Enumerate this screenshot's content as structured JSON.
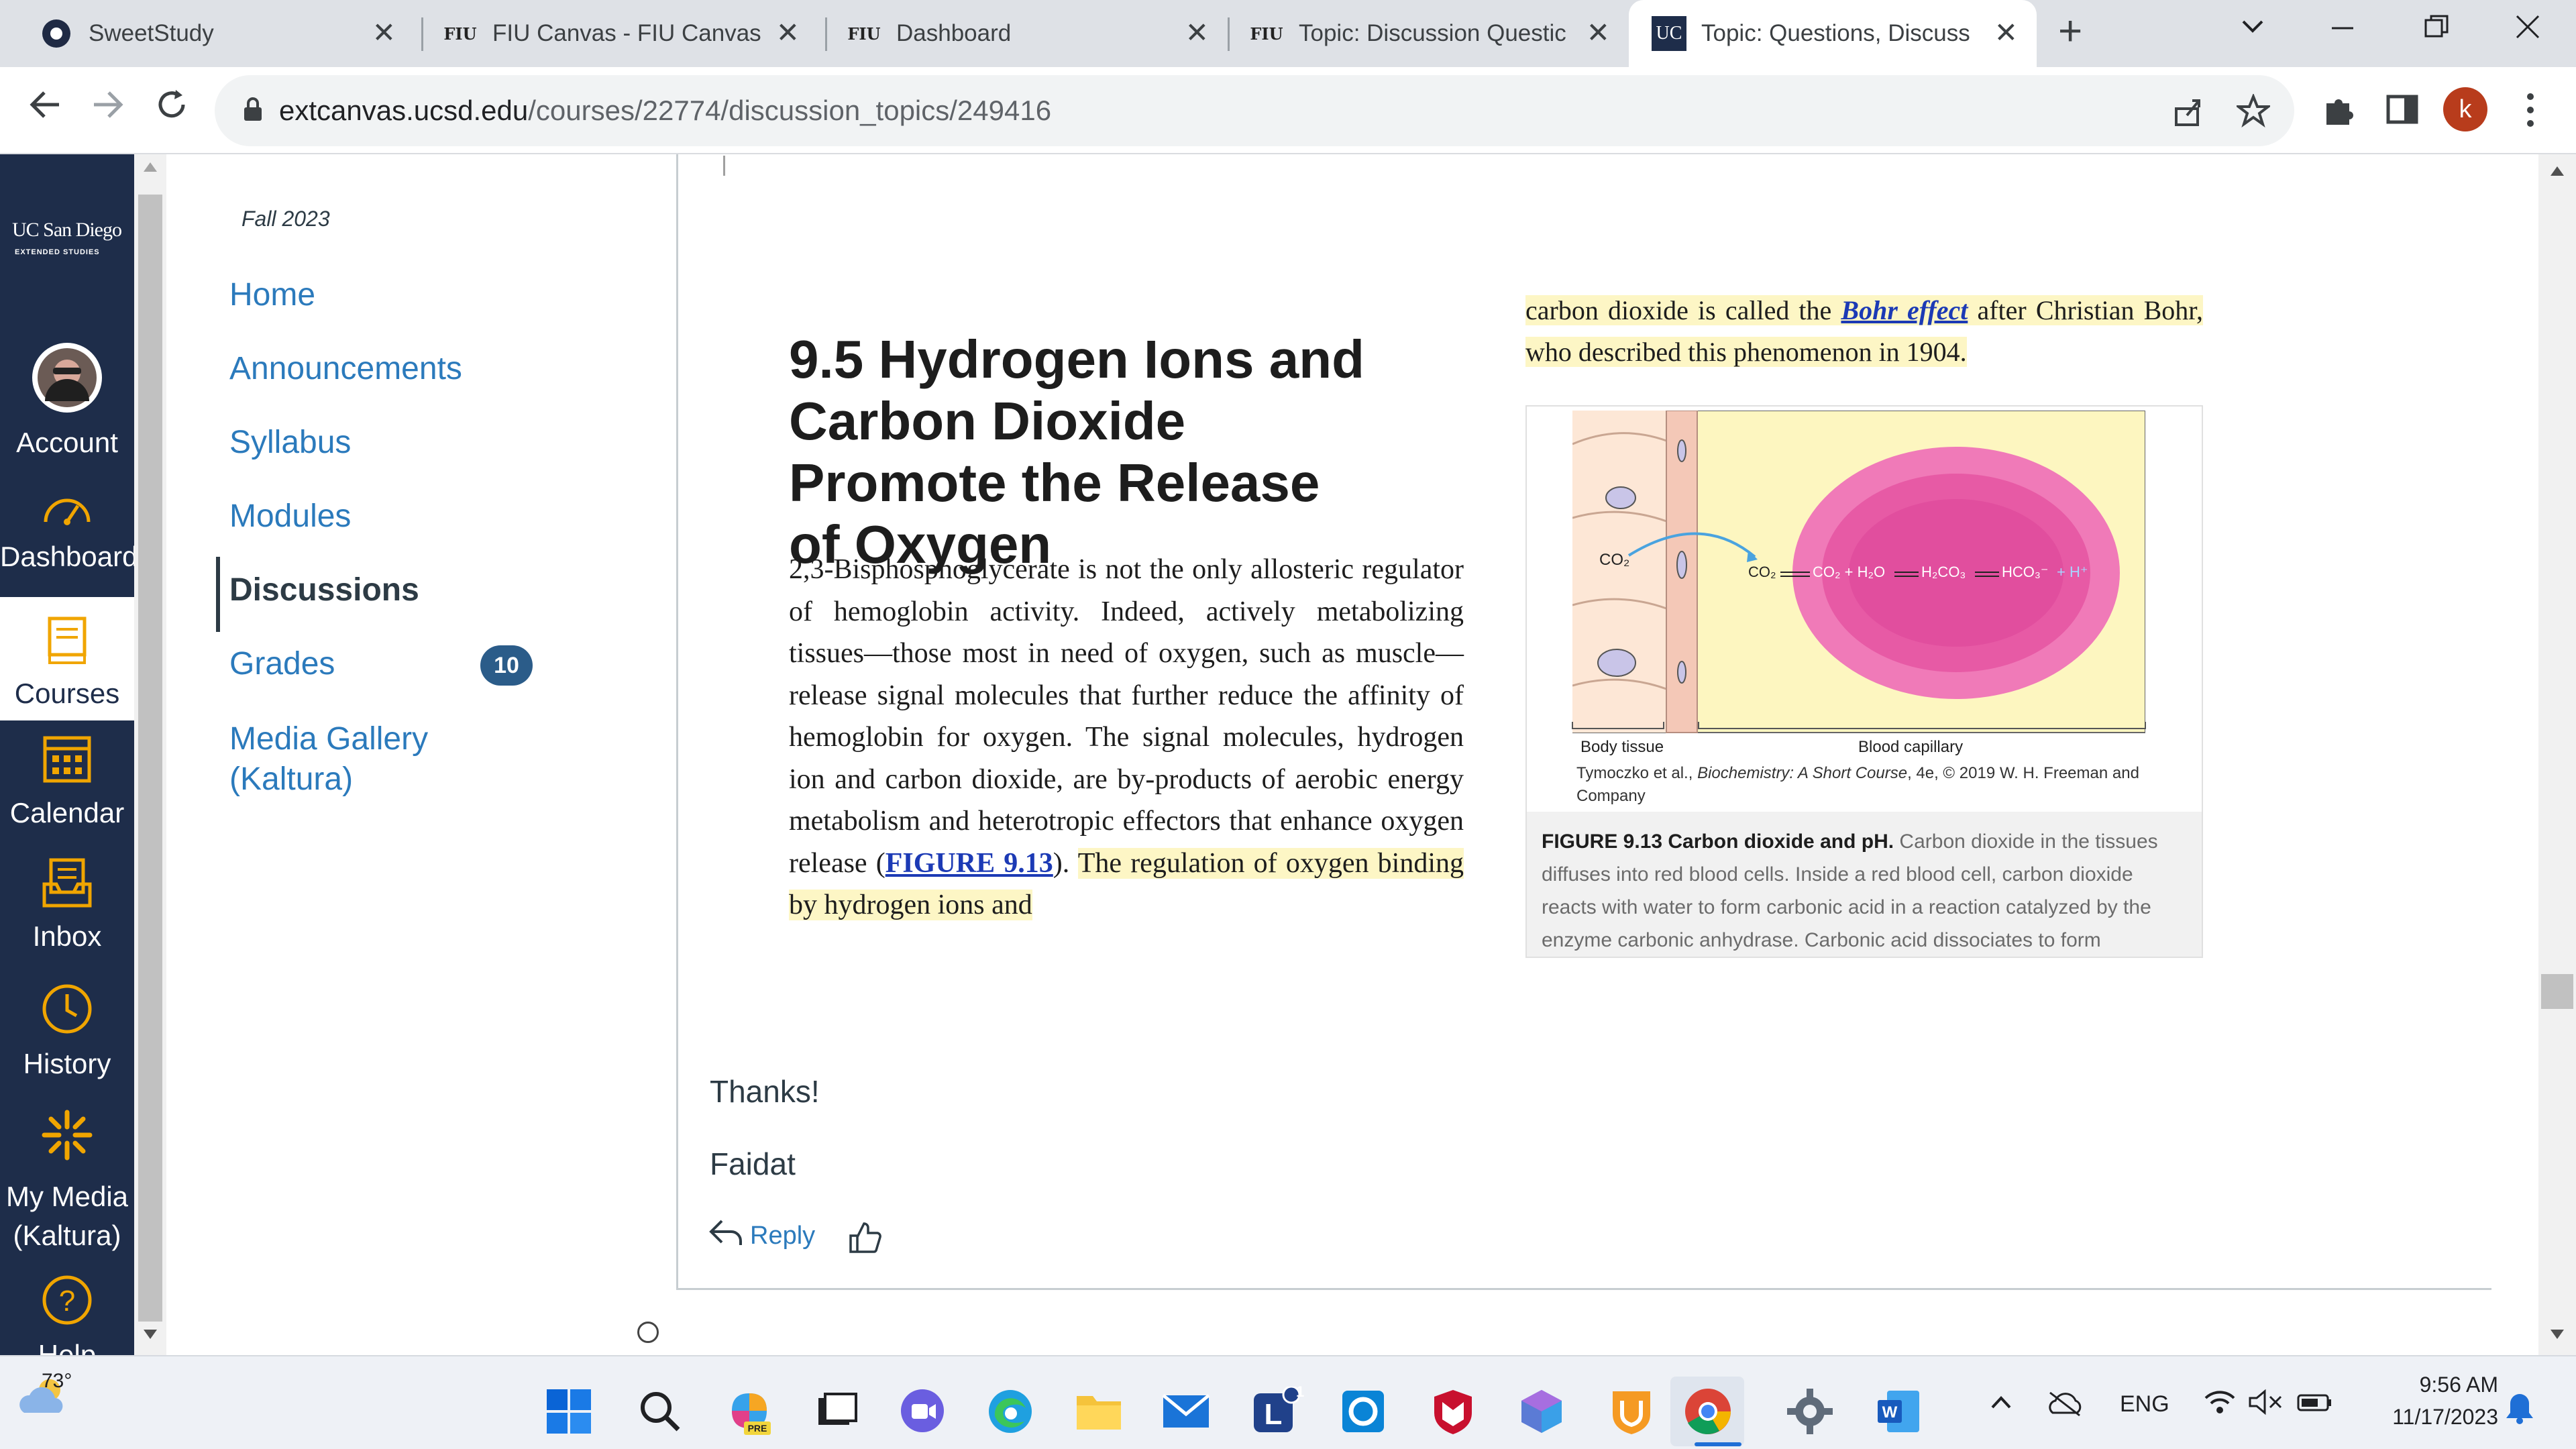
{
  "browser": {
    "tabs": [
      {
        "label": "SweetStudy"
      },
      {
        "label": "FIU Canvas - FIU Canvas"
      },
      {
        "label": "Dashboard"
      },
      {
        "label": "Topic: Discussion Questic"
      },
      {
        "label": "Topic: Questions, Discuss"
      }
    ],
    "tab_favicons": {
      "fiu": "FIU",
      "ucsd": "UC"
    },
    "url_host": "extcanvas.ucsd.edu",
    "url_path": "/courses/22774/discussion_topics/249416",
    "profile_initial": "k"
  },
  "global_nav": {
    "logo_main": "UC San Diego",
    "logo_sub": "EXTENDED STUDIES",
    "items": [
      {
        "label": "Account"
      },
      {
        "label": "Dashboard"
      },
      {
        "label": "Courses"
      },
      {
        "label": "Calendar"
      },
      {
        "label": "Inbox"
      },
      {
        "label": "History"
      },
      {
        "label": "My Media (Kaltura)"
      },
      {
        "label": "Help"
      }
    ]
  },
  "course_nav": {
    "term": "Fall 2023",
    "items": [
      {
        "label": "Home"
      },
      {
        "label": "Announcements"
      },
      {
        "label": "Syllabus"
      },
      {
        "label": "Modules"
      },
      {
        "label": "Discussions"
      },
      {
        "label": "Grades"
      },
      {
        "label": "Media Gallery (Kaltura)"
      }
    ],
    "grades_badge": "10"
  },
  "article": {
    "title": "9.5 Hydrogen Ions and Carbon Dioxide Promote the Release of Oxygen",
    "p_text": "2,3-Bisphosphoglycerate is not the only allosteric regulator of hemoglobin activity. Indeed, actively metabolizing tissues—those most in need of oxygen, such as muscle—release signal molecules that further reduce the affinity of hemoglobin for oxygen. The signal molecules, hydrogen ion and carbon dioxide, are by-products of aerobic energy metabolism and heterotropic effectors that enhance oxygen release (",
    "p_link": "FIGURE 9.13",
    "p_after": ").",
    "p_highlight": "The regulation of oxygen binding by hydrogen ions and",
    "right_pre": "carbon dioxide is called the ",
    "right_link": "Bohr effect",
    "right_post": " after Christian Bohr, who described this phenomenon in 1904."
  },
  "figure": {
    "co2_left": "CO₂",
    "eq_co2": "CO₂",
    "eq_co2_h2o": "CO₂ + H₂O",
    "eq_h2co3": "H₂CO₃",
    "eq_hco3": "HCO₃⁻",
    "eq_h": "+ H⁺",
    "label_body": "Body tissue",
    "label_capillary": "Blood capillary",
    "credit_pre": "Tymoczko et al., ",
    "credit_italic": "Biochemistry: A Short Course",
    "credit_post": ", 4e, © 2019 W. H. Freeman and Company",
    "caption_bold": "FIGURE 9.13 Carbon dioxide and pH.",
    "caption_text": " Carbon dioxide in the tissues diffuses into red blood cells. Inside a red blood cell, carbon dioxide reacts with water to form carbonic acid in a reaction catalyzed by the enzyme carbonic anhydrase. Carbonic acid dissociates to form"
  },
  "post": {
    "thanks": "Thanks!",
    "signature": "Faidat",
    "reply_label": "Reply"
  },
  "taskbar": {
    "weather": "73°",
    "lang": "ENG",
    "time": "9:56 AM",
    "date": "11/17/2023",
    "badge_l": "1"
  },
  "colors": {
    "nav_bg": "#1e2d4a",
    "link": "#2b7abc",
    "highlight": "#fdf6c5",
    "rbc_outer": "#f06fb2",
    "rbc_inner": "#e0409a",
    "figure_bg": "#fdf6c0"
  }
}
